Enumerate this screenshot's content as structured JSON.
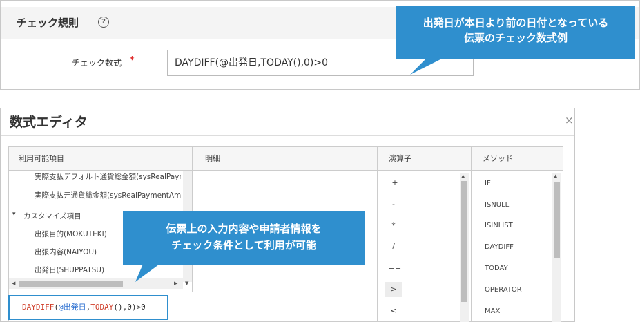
{
  "check_rule": {
    "title": "チェック規則",
    "help_icon": "?",
    "formula_label": "チェック数式",
    "required_mark": "*",
    "formula_value": "DAYDIFF(@出発日,TODAY(),0)>0"
  },
  "callouts": {
    "top": {
      "line1": "出発日が本日より前の日付となっている",
      "line2": "伝票のチェック数式例"
    },
    "middle": {
      "line1": "伝票上の入力内容や申請者情報を",
      "line2": "チェック条件として利用が可能"
    }
  },
  "editor": {
    "title": "数式エディタ",
    "close": "×",
    "columns": {
      "available": "利用可能項目",
      "detail": "明細",
      "operators": "演算子",
      "methods": "メソッド"
    },
    "tree_items": [
      "実際支払デフォルト通貨総金額(sysRealPaym",
      "実際支払元通貨総金額(sysRealPaymentAmo"
    ],
    "tree_group": {
      "toggle": "▾",
      "label": "カスタマイズ項目",
      "children": [
        "出張目的(MOKUTEKI)",
        "出張内容(NAIYOU)",
        "出発日(SHUPPATSU)"
      ]
    },
    "operators": [
      "+",
      "-",
      "*",
      "/",
      "==",
      ">",
      "<"
    ],
    "methods": [
      "IF",
      "ISNULL",
      "ISINLIST",
      "DAYDIFF",
      "TODAY",
      "OPERATOR",
      "MAX"
    ],
    "preview": {
      "func1": "DAYDIFF",
      "open1": "(",
      "var": "@出発日",
      "comma1": ",",
      "func2": "TODAY",
      "rest": "(),0)>0"
    }
  },
  "colors": {
    "accent": "#2f8fce",
    "function": "#d0402c",
    "variable": "#2b6fd0",
    "required": "#e03030"
  }
}
